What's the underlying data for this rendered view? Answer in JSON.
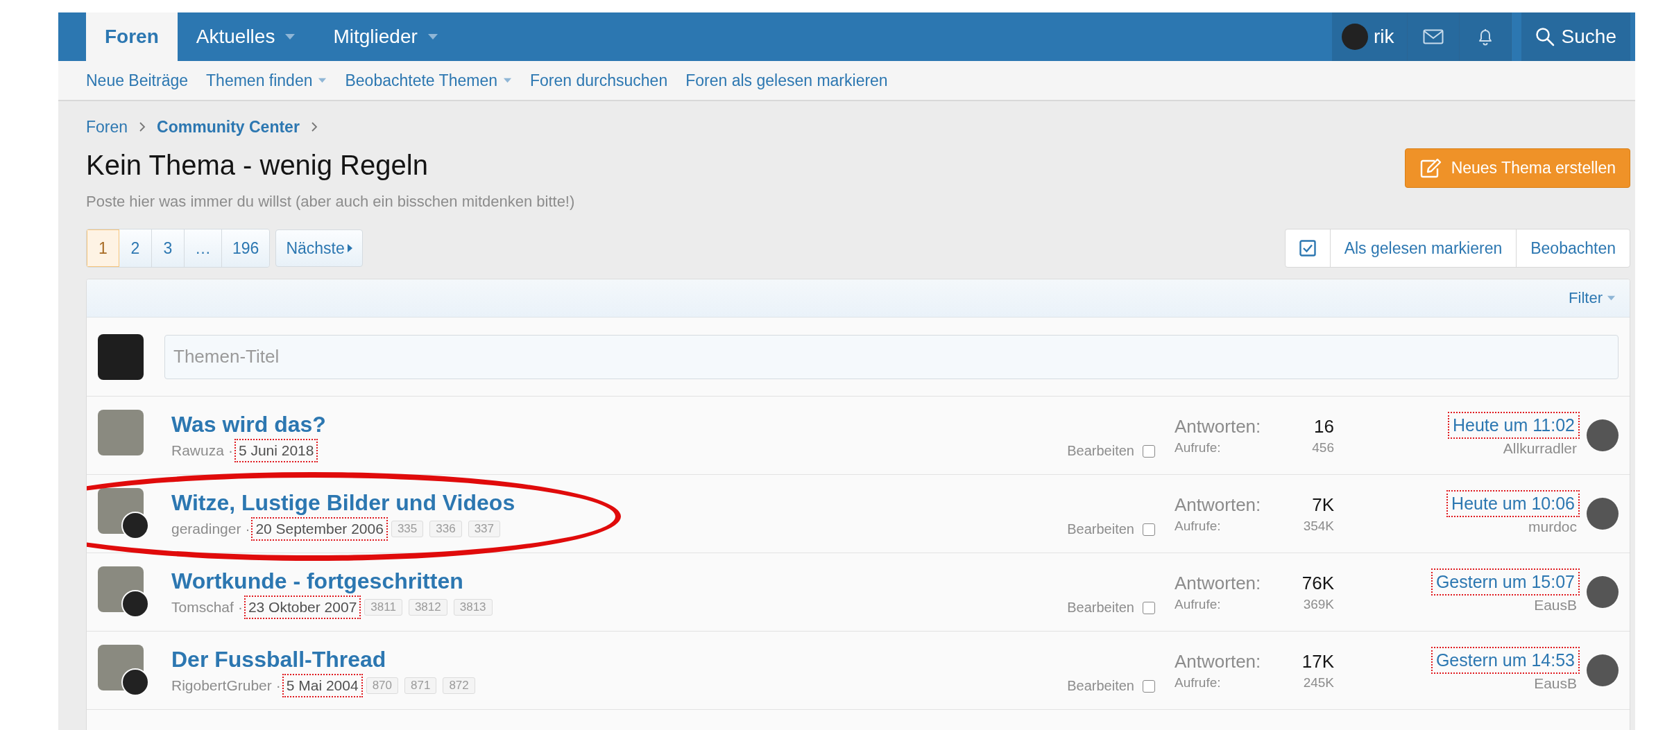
{
  "nav": {
    "tabs": [
      {
        "label": "Foren",
        "selected": true,
        "dropdown": false
      },
      {
        "label": "Aktuelles",
        "selected": false,
        "dropdown": true
      },
      {
        "label": "Mitglieder",
        "selected": false,
        "dropdown": true
      }
    ],
    "user": "rik",
    "search": "Suche"
  },
  "subnav": [
    {
      "label": "Neue Beiträge",
      "dropdown": false
    },
    {
      "label": "Themen finden",
      "dropdown": true
    },
    {
      "label": "Beobachtete Themen",
      "dropdown": true
    },
    {
      "label": "Foren durchsuchen",
      "dropdown": false
    },
    {
      "label": "Foren als gelesen markieren",
      "dropdown": false
    }
  ],
  "breadcrumb": [
    {
      "label": "Foren",
      "emphasis": false
    },
    {
      "label": "Community Center",
      "emphasis": true
    }
  ],
  "title": "Kein Thema - wenig Regeln",
  "description": "Poste hier was immer du willst (aber auch ein bisschen mitdenken bitte!)",
  "new_thread_button": "Neues Thema erstellen",
  "pagination": {
    "pages": [
      {
        "label": "1",
        "selected": true
      },
      {
        "label": "2",
        "selected": false
      },
      {
        "label": "3",
        "selected": false
      },
      {
        "label": "…",
        "selected": false
      },
      {
        "label": "196",
        "selected": false
      }
    ],
    "next": "Nächste"
  },
  "actions": [
    "Als gelesen markieren",
    "Beobachten"
  ],
  "filter": "Filter",
  "quick_thread": {
    "placeholder": "Themen-Titel"
  },
  "threads": [
    {
      "title": "Was wird das?",
      "author": "Rawuza",
      "separator": "·",
      "date": "5 Juni 2018",
      "date_marked": true,
      "starter_badge": false,
      "edit": "Bearbeiten",
      "edit_checked": false,
      "replies_label": "Antworten:",
      "replies": "16",
      "views_label": "Aufrufe:",
      "views": "456",
      "last_time": "Heute um 11:02",
      "last_time_marked": true,
      "last_user": "Allkurradler",
      "circled": false
    },
    {
      "title": "Witze, Lustige Bilder und Videos",
      "author": "geradinger",
      "separator": "·",
      "date": "20 September 2006",
      "date_marked": true,
      "pages": [
        "335",
        "336",
        "337"
      ],
      "starter_badge": true,
      "edit": "Bearbeiten",
      "edit_checked": false,
      "replies_label": "Antworten:",
      "replies": "7K",
      "views_label": "Aufrufe:",
      "views": "354K",
      "last_time": "Heute um 10:06",
      "last_time_marked": true,
      "last_user": "murdoc",
      "circled": true
    },
    {
      "title": "Wortkunde - fortgeschritten",
      "author": "Tomschaf",
      "separator": "·",
      "date": "23 Oktober 2007",
      "date_marked": true,
      "pages": [
        "3811",
        "3812",
        "3813"
      ],
      "starter_badge": true,
      "edit": "Bearbeiten",
      "edit_checked": false,
      "replies_label": "Antworten:",
      "replies": "76K",
      "views_label": "Aufrufe:",
      "views": "369K",
      "last_time": "Gestern um 15:07",
      "last_time_marked": true,
      "last_user": "EausB",
      "circled": false
    },
    {
      "title": "Der Fussball-Thread",
      "author": "RigobertGruber",
      "separator": "·",
      "date": "5 Mai 2004",
      "date_marked": true,
      "pages": [
        "870",
        "871",
        "872"
      ],
      "starter_badge": true,
      "edit": "Bearbeiten",
      "edit_checked": false,
      "replies_label": "Antworten:",
      "replies": "17K",
      "views_label": "Aufrufe:",
      "views": "245K",
      "last_time": "Gestern um 14:53",
      "last_time_marked": true,
      "last_user": "EausB",
      "circled": false
    }
  ]
}
